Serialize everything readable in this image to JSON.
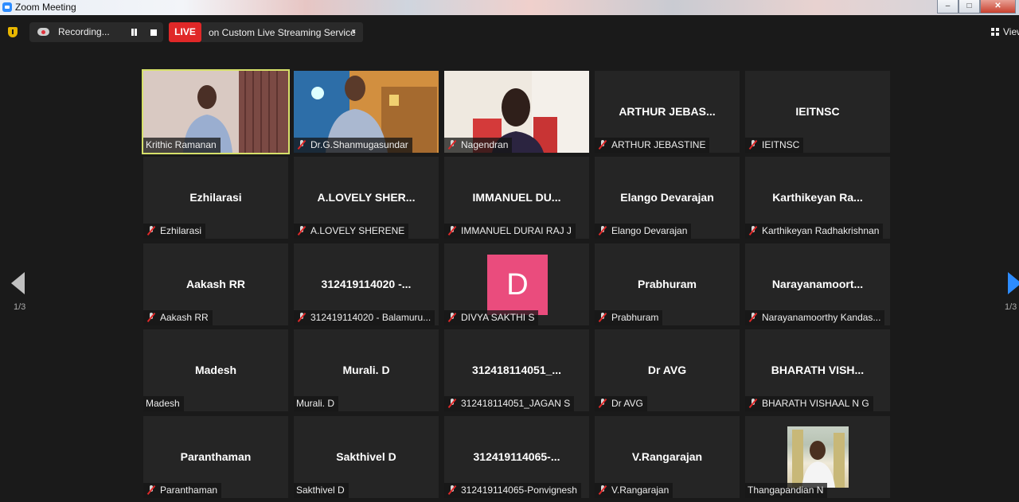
{
  "window": {
    "title": "Zoom Meeting",
    "minimize": "–",
    "maximize": "□",
    "close": "✕"
  },
  "toolbar": {
    "recording_label": "Recording...",
    "live_badge": "LIVE",
    "live_service": "on Custom Live Streaming Service",
    "live_caret": "▾",
    "view_label": "View"
  },
  "pager": {
    "left_label": "1/3",
    "right_label": "1/3"
  },
  "icons": {
    "security": "shield-icon",
    "recording": "cloud-record-icon",
    "pause": "pause-icon",
    "stop": "stop-icon",
    "view": "grid-view-icon",
    "mute": "mic-muted-icon",
    "prev": "chevron-left-icon",
    "next": "chevron-right-icon"
  },
  "colors": {
    "live": "#e02828",
    "active_speaker": "#d6e06a",
    "nav_active": "#2d8cff",
    "avatar_D": "#ea4c7d"
  },
  "participants": [
    {
      "name": "Krithic Ramanan",
      "big": "",
      "muted": false,
      "video": "krithic"
    },
    {
      "name": "Dr.G.Shanmugasundar",
      "big": "",
      "muted": true,
      "video": "shanmuga"
    },
    {
      "name": "Nagendran",
      "big": "",
      "muted": true,
      "video": "nagendran"
    },
    {
      "name": "ARTHUR JEBASTINE",
      "big": "ARTHUR JEBAS...",
      "muted": true
    },
    {
      "name": "IEITNSC",
      "big": "IEITNSC",
      "muted": true
    },
    {
      "name": "Ezhilarasi",
      "big": "Ezhilarasi",
      "muted": true
    },
    {
      "name": "A.LOVELY SHERENE",
      "big": "A.LOVELY SHER...",
      "muted": true
    },
    {
      "name": "IMMANUEL DURAI RAJ J",
      "big": "IMMANUEL DU...",
      "muted": true
    },
    {
      "name": "Elango Devarajan",
      "big": "Elango Devarajan",
      "muted": true
    },
    {
      "name": "Karthikeyan Radhakrishnan",
      "big": "Karthikeyan Ra...",
      "muted": true
    },
    {
      "name": "Aakash RR",
      "big": "Aakash RR",
      "muted": true
    },
    {
      "name": "312419114020 - Balamuru...",
      "big": "312419114020 -...",
      "muted": true
    },
    {
      "name": "DIVYA SAKTHI S",
      "big": "",
      "muted": true,
      "avatar": "D"
    },
    {
      "name": "Prabhuram",
      "big": "Prabhuram",
      "muted": true
    },
    {
      "name": "Narayanamoorthy Kandas...",
      "big": "Narayanamoort...",
      "muted": true
    },
    {
      "name": "Madesh",
      "big": "Madesh",
      "muted": false
    },
    {
      "name": "Murali. D",
      "big": "Murali. D",
      "muted": false
    },
    {
      "name": "312418114051_JAGAN S",
      "big": "312418114051_...",
      "muted": true
    },
    {
      "name": "Dr AVG",
      "big": "Dr AVG",
      "muted": true
    },
    {
      "name": "BHARATH VISHAAL N G",
      "big": "BHARATH VISH...",
      "muted": true
    },
    {
      "name": "Paranthaman",
      "big": "Paranthaman",
      "muted": true
    },
    {
      "name": "Sakthivel D",
      "big": "Sakthivel D",
      "muted": false
    },
    {
      "name": "312419114065-Ponvignesh",
      "big": "312419114065-...",
      "muted": true
    },
    {
      "name": "V.Rangarajan",
      "big": "V.Rangarajan",
      "muted": true
    },
    {
      "name": "Thangapandian N",
      "big": "",
      "muted": false,
      "thumbnail": true
    }
  ]
}
